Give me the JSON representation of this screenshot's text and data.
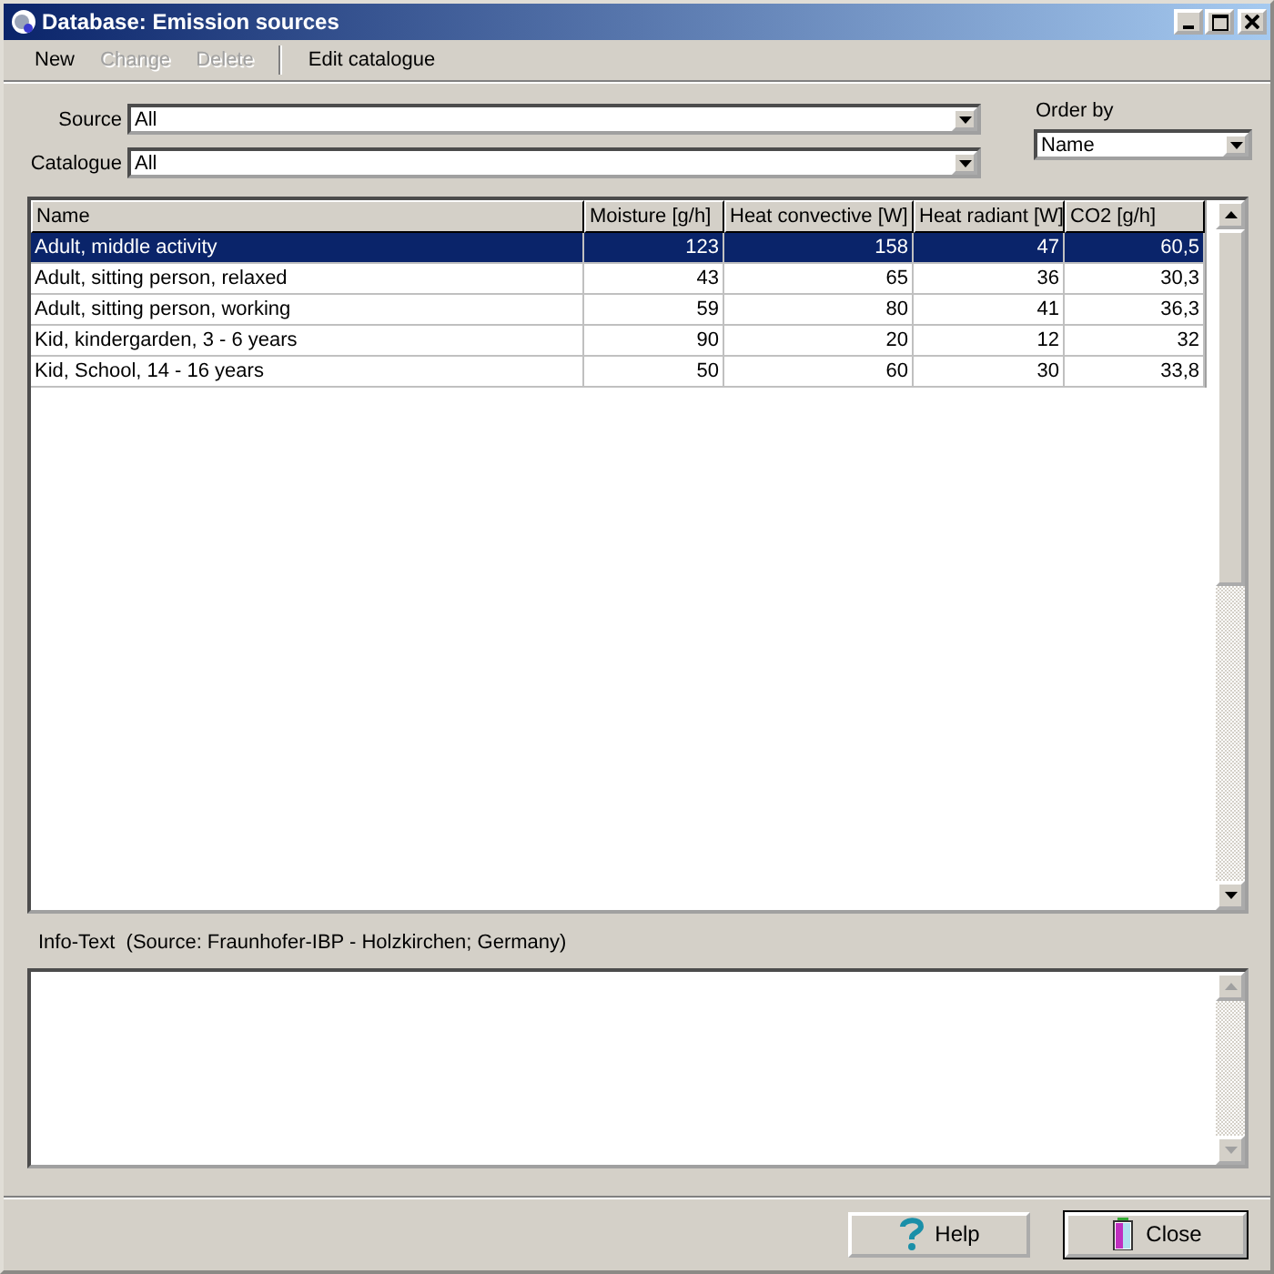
{
  "window": {
    "title": "Database: Emission sources"
  },
  "toolbar": [
    {
      "label": "New",
      "disabled": false
    },
    {
      "label": "Change",
      "disabled": true
    },
    {
      "label": "Delete",
      "disabled": true
    },
    {
      "label": "Edit catalogue",
      "disabled": false,
      "separator_before": true
    }
  ],
  "filters": [
    {
      "label": "Source",
      "value": "All"
    },
    {
      "label": "Catalogue",
      "value": "All"
    }
  ],
  "order_by": {
    "label": "Order by",
    "value": "Name"
  },
  "table": {
    "columns": [
      "Name",
      "Moisture [g/h]",
      "Heat convective [W]",
      "Heat radiant [W]",
      "CO2 [g/h]"
    ],
    "rows": [
      {
        "cells": [
          "Adult, middle activity",
          "123",
          "158",
          "47",
          "60,5"
        ],
        "selected": true
      },
      {
        "cells": [
          "Adult, sitting person, relaxed",
          "43",
          "65",
          "36",
          "30,3"
        ],
        "selected": false
      },
      {
        "cells": [
          "Adult, sitting person, working",
          "59",
          "80",
          "41",
          "36,3"
        ],
        "selected": false
      },
      {
        "cells": [
          "Kid, kindergarden, 3 - 6 years",
          "90",
          "20",
          "12",
          "32"
        ],
        "selected": false
      },
      {
        "cells": [
          "Kid, School, 14 - 16 years",
          "50",
          "60",
          "30",
          "33,8"
        ],
        "selected": false
      }
    ]
  },
  "info": {
    "label": "Info-Text  (Source: Fraunhofer-IBP - Holzkirchen; Germany)"
  },
  "buttons": [
    {
      "kind": "help",
      "label": "Help",
      "focused": false
    },
    {
      "kind": "close",
      "label": "Close",
      "focused": true
    }
  ]
}
